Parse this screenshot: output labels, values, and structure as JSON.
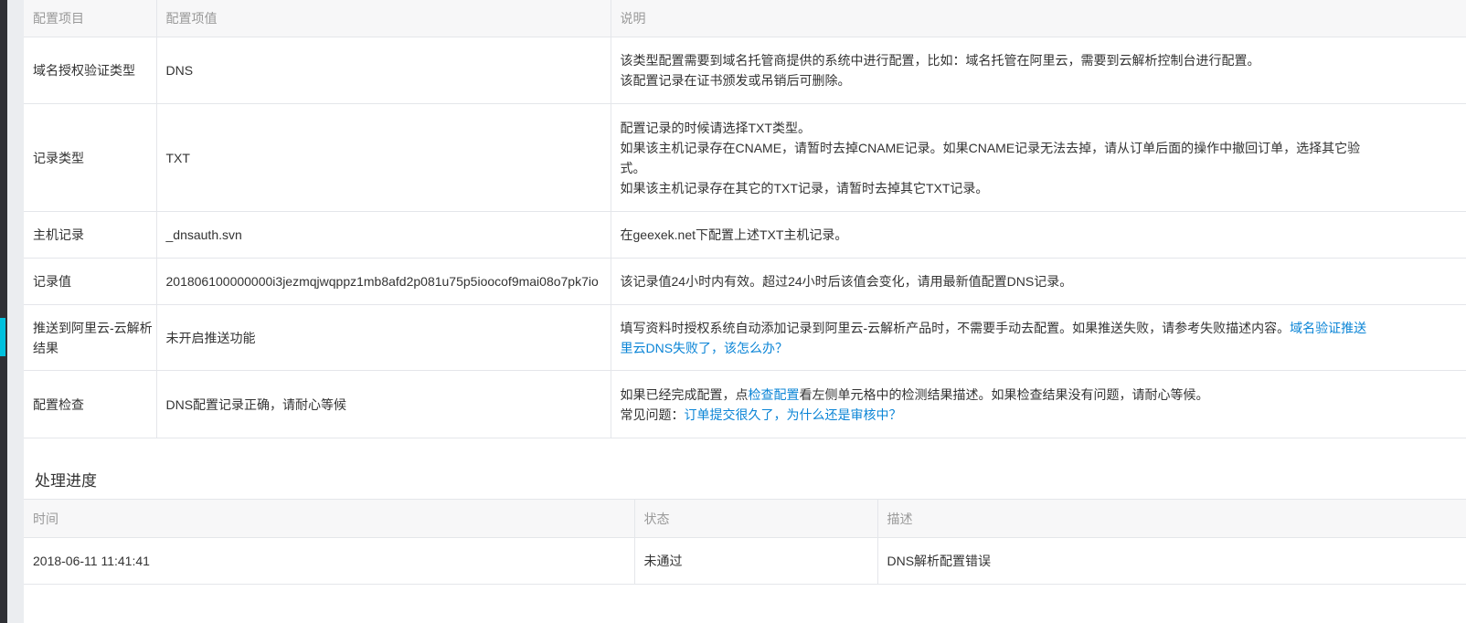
{
  "config_table": {
    "headers": [
      "配置项目",
      "配置项值",
      "说明"
    ],
    "rows": [
      {
        "key": "域名授权验证类型",
        "value": "DNS",
        "desc": [
          "该类型配置需要到域名托管商提供的系统中进行配置，比如：域名托管在阿里云，需要到云解析控制台进行配置。",
          "该配置记录在证书颁发或吊销后可删除。"
        ]
      },
      {
        "key": "记录类型",
        "value": "TXT",
        "desc": [
          "配置记录的时候请选择TXT类型。",
          "如果该主机记录存在CNAME，请暂时去掉CNAME记录。如果CNAME记录无法去掉，请从订单后面的操作中撤回订单，选择其它验",
          "式。",
          "如果该主机记录存在其它的TXT记录，请暂时去掉其它TXT记录。"
        ]
      },
      {
        "key": "主机记录",
        "value": "_dnsauth.svn",
        "desc": [
          "在geexek.net下配置上述TXT主机记录。"
        ]
      },
      {
        "key": "记录值",
        "value": "201806100000000i3jezmqjwqppz1mb8afd2p081u75p5ioocof9mai08o7pk7io",
        "desc": [
          "该记录值24小时内有效。超过24小时后该值会变化，请用最新值配置DNS记录。"
        ]
      },
      {
        "key_line1": "推送到阿里云-云解析",
        "key_line2": "结果",
        "value": "未开启推送功能",
        "desc_line1_text": "填写资料时授权系统自动添加记录到阿里云-云解析产品时，不需要手动去配置。如果推送失败，请参考失败描述内容。",
        "desc_line1_link": "域名验证推送",
        "desc_line2_link": "里云DNS失败了，该怎么办？"
      },
      {
        "key": "配置检查",
        "value": "DNS配置记录正确，请耐心等候",
        "desc_pre": "如果已经完成配置，点",
        "desc_link": "检查配置",
        "desc_post": "看左侧单元格中的检测结果描述。如果检查结果没有问题，请耐心等候。",
        "faq_label": "常见问题：",
        "faq_link": "订单提交很久了，为什么还是审核中？"
      }
    ]
  },
  "progress": {
    "title": "处理进度",
    "headers": [
      "时间",
      "状态",
      "描述"
    ],
    "rows": [
      {
        "time": "2018-06-11 11:41:41",
        "status": "未通过",
        "desc": "DNS解析配置错误"
      }
    ]
  },
  "colors": {
    "link": "#0a84d6",
    "sidebar": "#2f3035",
    "sidebar_accent": "#00c1de",
    "header_bg": "#f7f7f8",
    "border": "#e4e6ea"
  }
}
